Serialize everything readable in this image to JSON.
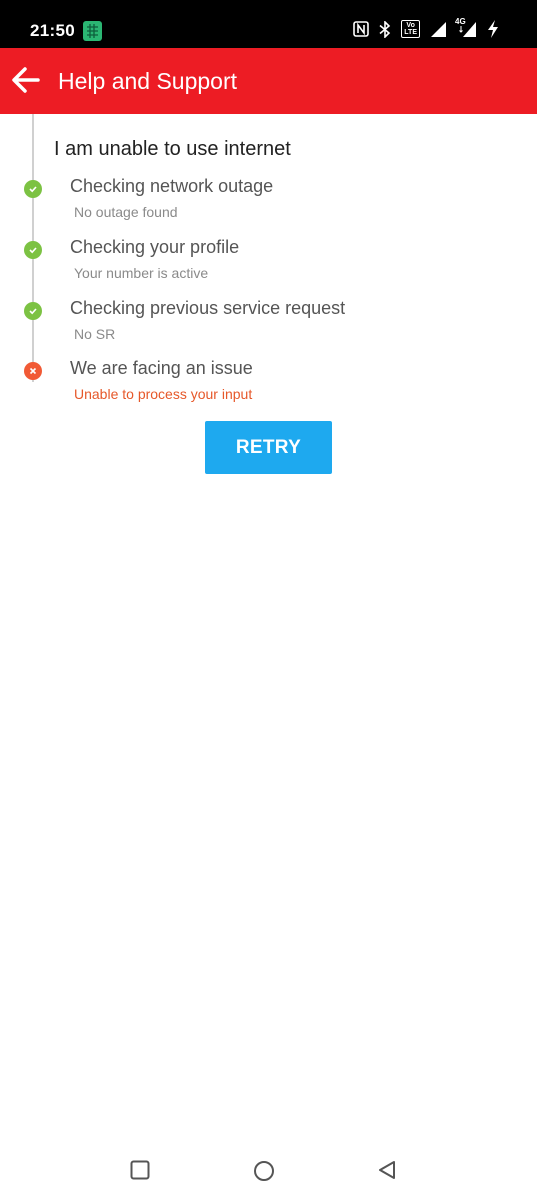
{
  "status_bar": {
    "time": "21:50",
    "icons": [
      "app-grid-icon",
      "nfc-icon",
      "bluetooth-icon",
      "volte-icon",
      "signal-icon",
      "signal-4g-icon",
      "battery-charging-icon"
    ],
    "volte_top": "Vo",
    "volte_bottom": "LTE",
    "network_label": "4G"
  },
  "app_bar": {
    "title": "Help and Support",
    "back_icon": "arrow-left-icon",
    "color": "#ed1c24"
  },
  "main": {
    "heading": "I am unable to use internet",
    "steps": [
      {
        "title": "Checking network outage",
        "description": "No outage found",
        "status": "success"
      },
      {
        "title": "Checking your profile",
        "description": "Your number is active",
        "status": "success"
      },
      {
        "title": "Checking previous service request",
        "description": "No SR",
        "status": "success"
      },
      {
        "title": "We are facing an issue",
        "description": "Unable to process your input",
        "status": "error"
      }
    ],
    "retry_label": "RETRY",
    "colors": {
      "success": "#7cc243",
      "error": "#f15a35",
      "button": "#1ea9ef"
    }
  },
  "nav_bar": {
    "buttons": [
      "recents-square-icon",
      "home-circle-icon",
      "back-triangle-icon"
    ]
  }
}
